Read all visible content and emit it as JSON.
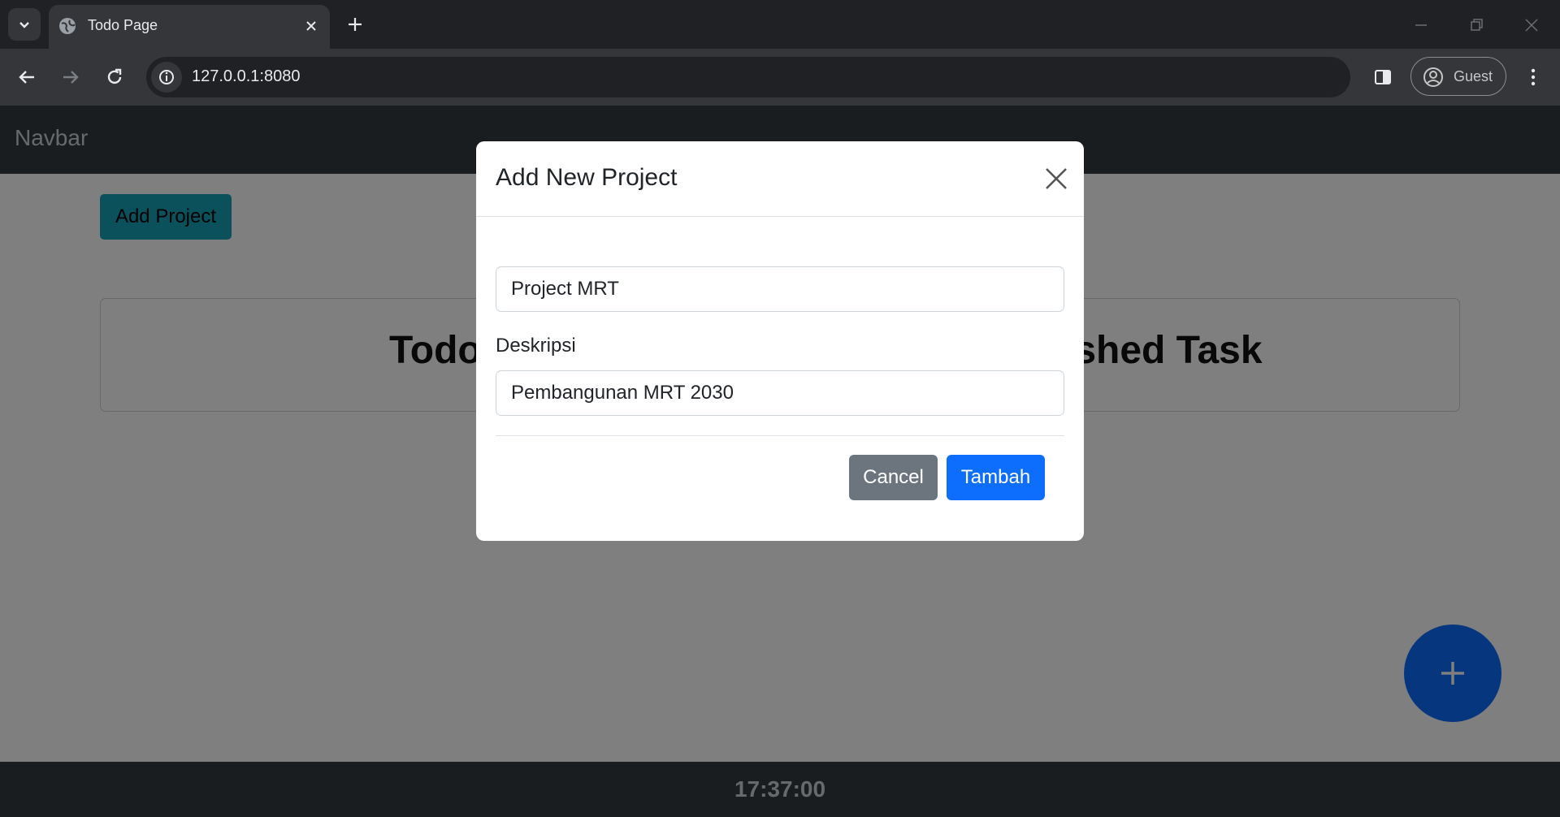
{
  "browser": {
    "tab_title": "Todo Page",
    "url": "127.0.0.1:8080",
    "profile_label": "Guest"
  },
  "page": {
    "navbar_brand": "Navbar",
    "add_project_label": "Add Project",
    "columns": [
      "Todo",
      "Finished Task"
    ],
    "clock": "17:37:00",
    "fab_icon": "plus-icon"
  },
  "modal": {
    "title": "Add New Project",
    "project_name_value": "Project MRT",
    "description_label": "Deskripsi",
    "description_value": "Pembangunan MRT 2030",
    "cancel_label": "Cancel",
    "submit_label": "Tambah"
  },
  "colors": {
    "navbar": "#343a40",
    "add_project": "#17a2b8",
    "primary": "#0d6efd",
    "secondary": "#6c757d"
  }
}
